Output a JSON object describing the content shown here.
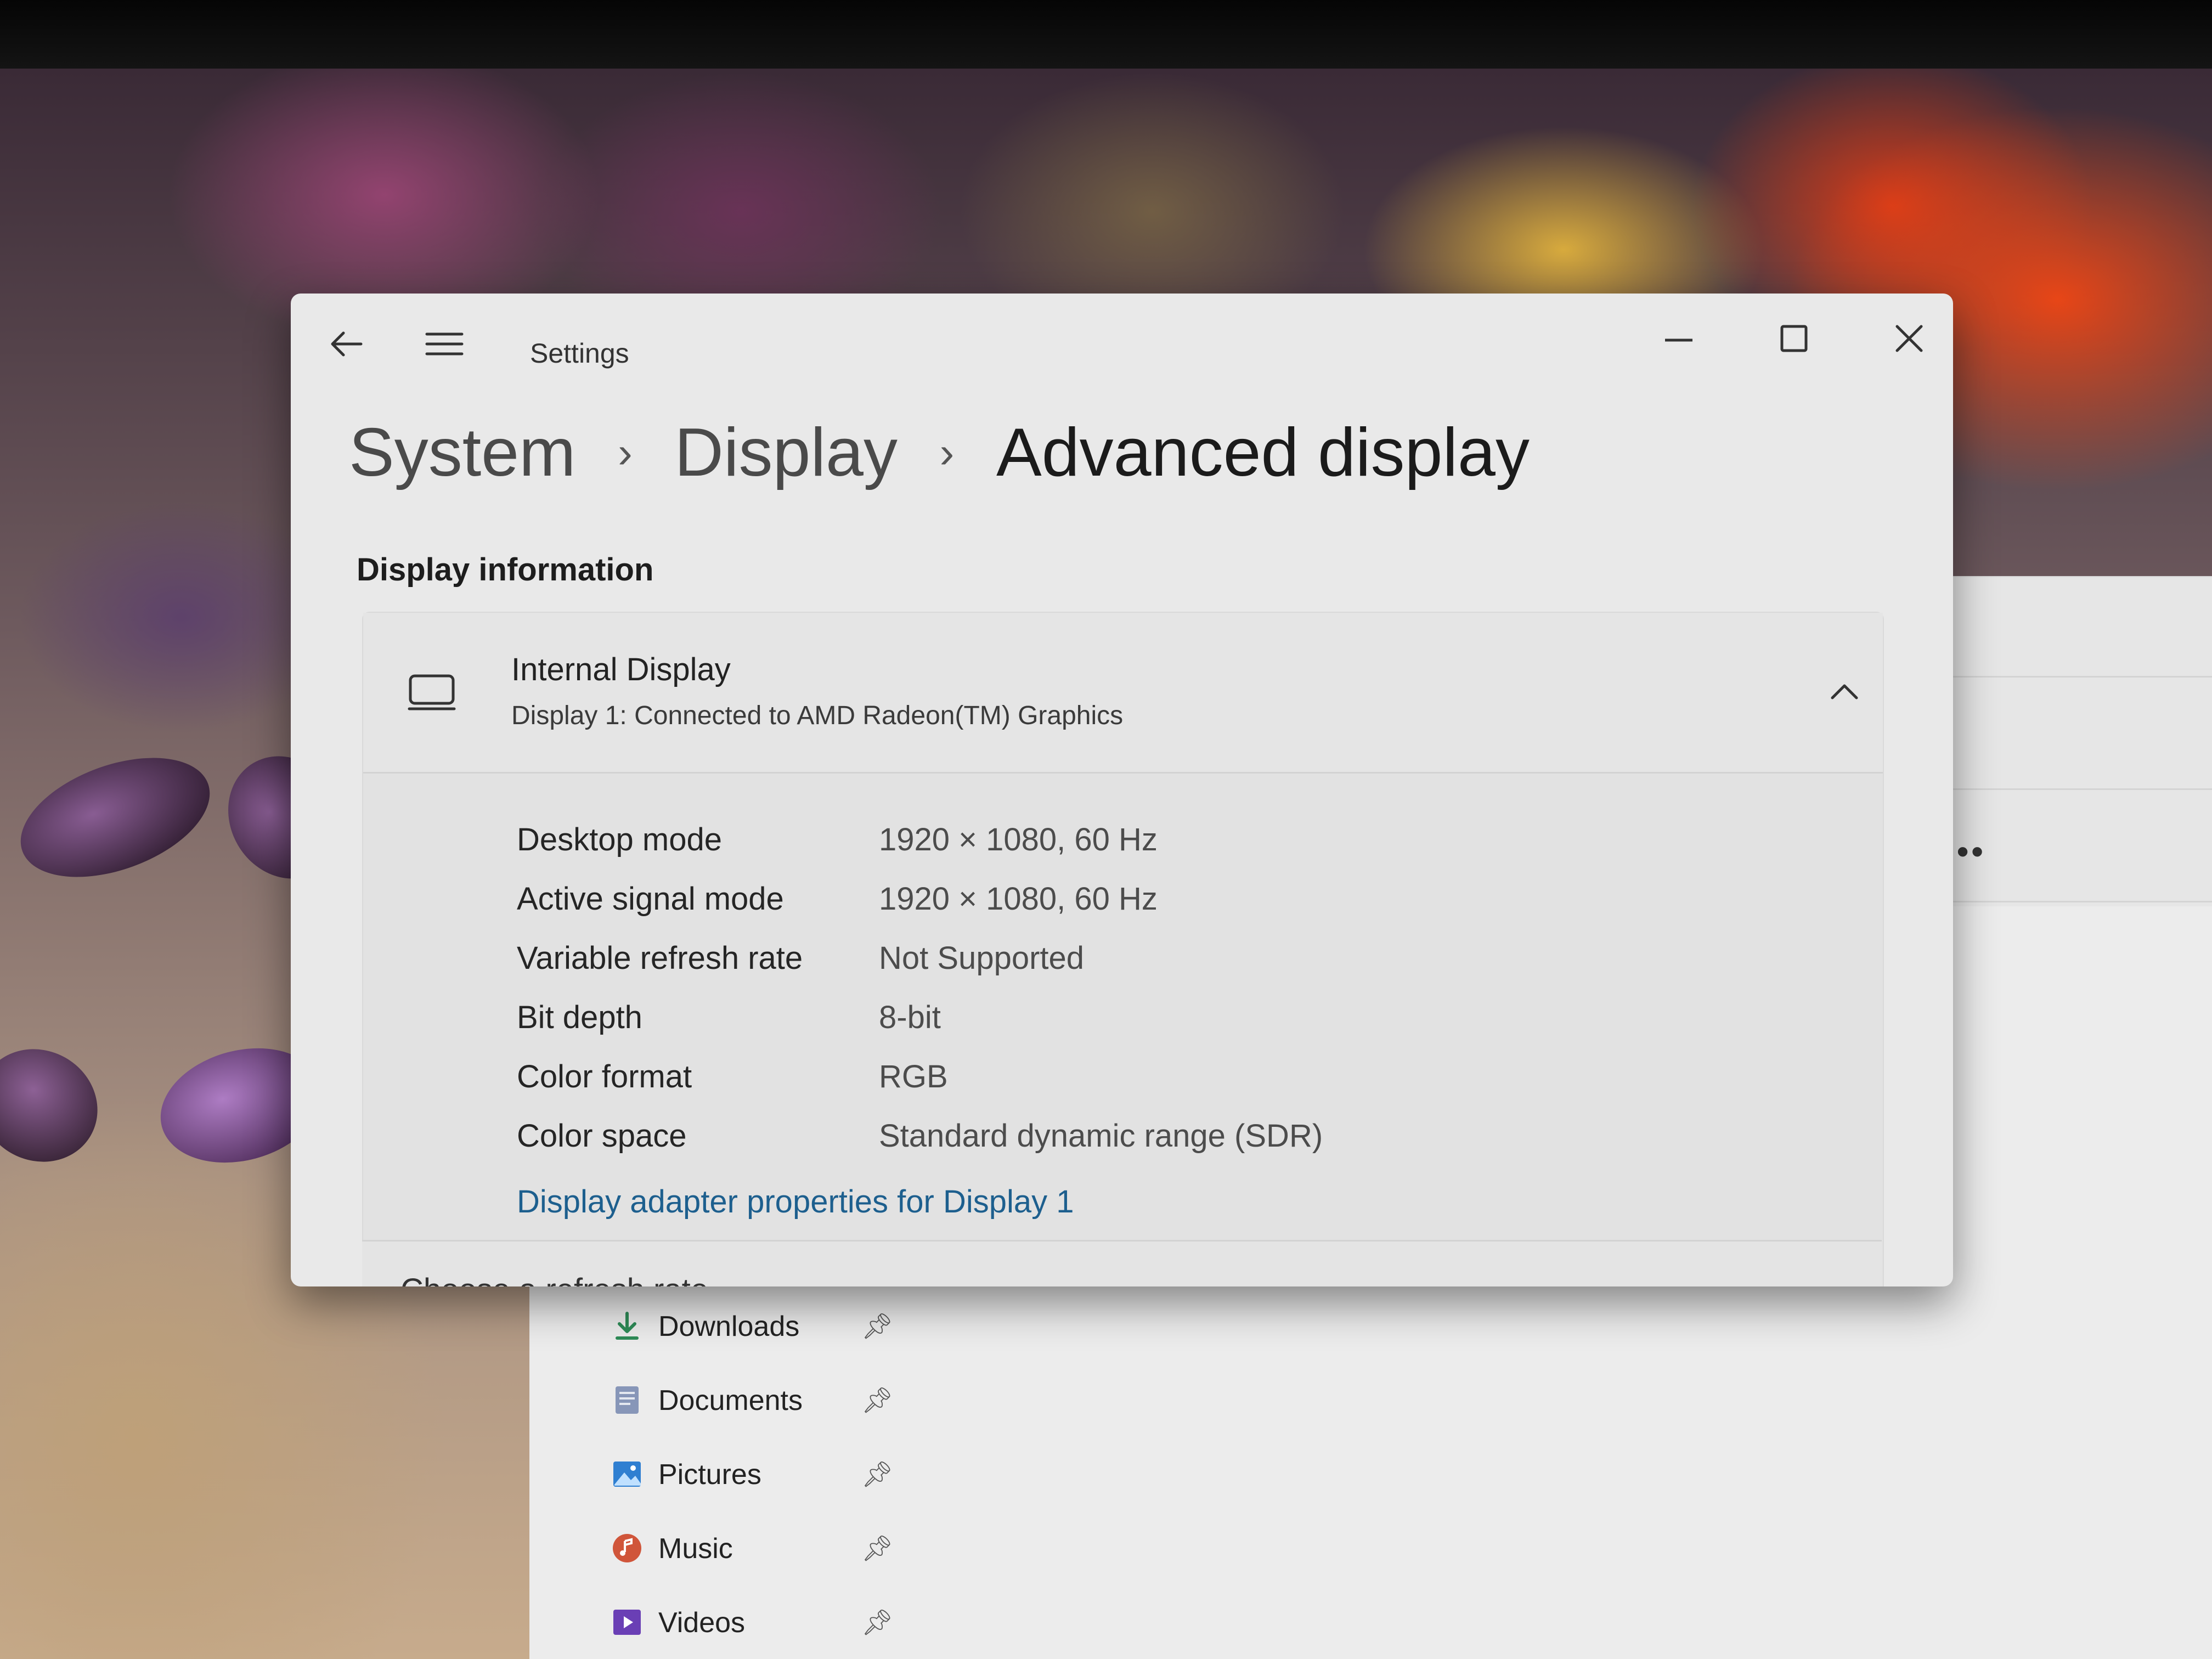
{
  "settings_window": {
    "app_title": "Settings",
    "breadcrumb": [
      "System",
      "Display",
      "Advanced display"
    ],
    "section_title": "Display information",
    "display_card": {
      "title": "Internal Display",
      "subtitle": "Display 1: Connected to AMD Radeon(TM) Graphics",
      "properties": [
        {
          "label": "Desktop mode",
          "value": "1920 × 1080, 60 Hz"
        },
        {
          "label": "Active signal mode",
          "value": "1920 × 1080, 60 Hz"
        },
        {
          "label": "Variable refresh rate",
          "value": "Not Supported"
        },
        {
          "label": "Bit depth",
          "value": "8-bit"
        },
        {
          "label": "Color format",
          "value": "RGB"
        },
        {
          "label": "Color space",
          "value": "Standard dynamic range (SDR)"
        }
      ],
      "link": "Display adapter properties for Display 1"
    },
    "next_card_partial_text": "Choose a refresh rate"
  },
  "file_explorer": {
    "more_button": "•••",
    "quick_access": [
      {
        "label": "Downloads",
        "icon": "download-icon",
        "color": "#2e8b57"
      },
      {
        "label": "Documents",
        "icon": "document-icon",
        "color": "#6c7ea3"
      },
      {
        "label": "Pictures",
        "icon": "pictures-icon",
        "color": "#2f7fd1"
      },
      {
        "label": "Music",
        "icon": "music-icon",
        "color": "#d0553a"
      },
      {
        "label": "Videos",
        "icon": "videos-icon",
        "color": "#6a3fb5"
      }
    ]
  },
  "colors": {
    "link": "#1d5f8e",
    "window_bg": "#e9e9e9",
    "card_bg": "#e2e2e2"
  }
}
